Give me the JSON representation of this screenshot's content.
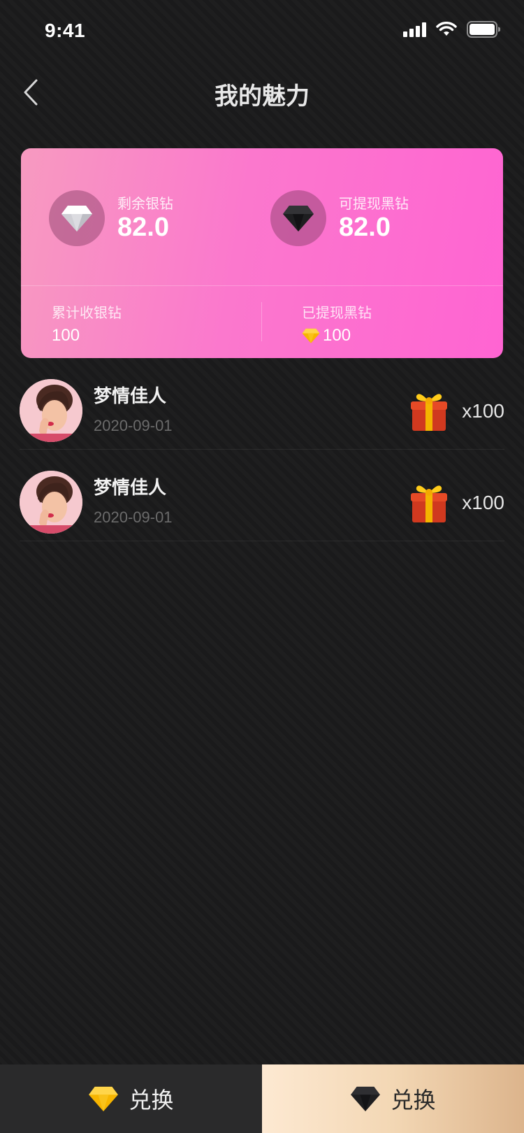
{
  "status_bar": {
    "time": "9:41"
  },
  "nav": {
    "title": "我的魅力",
    "back_icon": "chevron-left-icon"
  },
  "card": {
    "colors": {
      "gradient_start": "#f79ac0",
      "gradient_end": "#ff64d2"
    },
    "silver": {
      "label": "剩余银钻",
      "value": "82.0",
      "icon": "silver-diamond-icon"
    },
    "black": {
      "label": "可提现黑钻",
      "value": "82.0",
      "icon": "black-diamond-icon"
    },
    "total_received": {
      "label": "累计收银钻",
      "value": "100"
    },
    "withdrawn": {
      "label": "已提现黑钻",
      "value": "100",
      "icon": "gold-diamond-icon"
    }
  },
  "records": [
    {
      "name": "梦情佳人",
      "date": "2020-09-01",
      "gift_icon": "gift-box-icon",
      "count": "x100"
    },
    {
      "name": "梦情佳人",
      "date": "2020-09-01",
      "gift_icon": "gift-box-icon",
      "count": "x100"
    }
  ],
  "bottom_bar": {
    "silver_exchange": {
      "label": "兑换",
      "icon": "gold-diamond-icon"
    },
    "black_exchange": {
      "label": "兑换",
      "icon": "black-diamond-icon"
    },
    "colors": {
      "left_bg": "#2a2a2b",
      "right_bg_start": "#fde9d2",
      "right_bg_end": "#dcb48c"
    }
  }
}
